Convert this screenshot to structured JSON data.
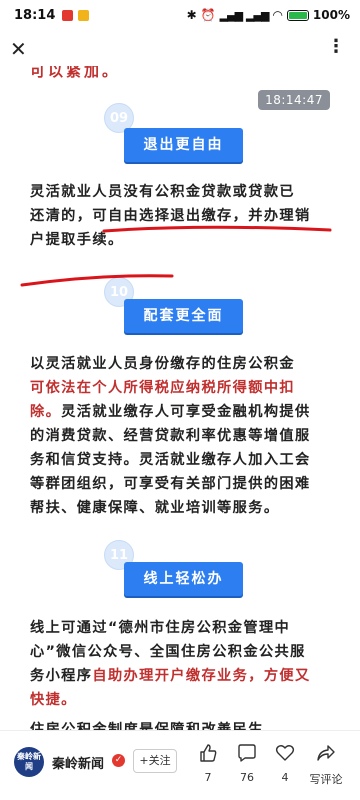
{
  "status_bar": {
    "time": "18:14",
    "battery": "100%"
  },
  "article": {
    "prev_text": "可以紧加。",
    "timestamp": "18:14:47",
    "sections": [
      {
        "number": "09",
        "title": "退出更自由",
        "lines": [
          [
            {
              "t": "灵活就业人员没有公积金贷款或贷款已",
              "red": false
            }
          ],
          [
            {
              "t": "还清的，可自由选择退出缴存，并办理销",
              "red": false
            }
          ],
          [
            {
              "t": "户提取手续。",
              "red": false
            }
          ]
        ]
      },
      {
        "number": "10",
        "title": "配套更全面",
        "lines": [
          [
            {
              "t": "以灵活就业人员身份缴存的住房公积金",
              "red": false
            }
          ],
          [
            {
              "t": "可依法在个人所得税应纳税所得额中扣",
              "red": true
            }
          ],
          [
            {
              "t": "除。",
              "red": true
            },
            {
              "t": "灵活就业缴存人可享受金融机构提供",
              "red": false
            }
          ],
          [
            {
              "t": "的消费贷款、经营贷款利率优惠等增值服",
              "red": false
            }
          ],
          [
            {
              "t": "务和信贷支持。灵活就业缴存人加入工会",
              "red": false
            }
          ],
          [
            {
              "t": "等群团组织，可享受有关部门提供的困难",
              "red": false
            }
          ],
          [
            {
              "t": "帮扶、健康保障、就业培训等服务。",
              "red": false
            }
          ]
        ]
      },
      {
        "number": "11",
        "title": "线上轻松办",
        "lines": [
          [
            {
              "t": "线上可通过“德州市住房公积金管理中",
              "red": false
            }
          ],
          [
            {
              "t": "心”微信公众号、全国住房公积金公共服",
              "red": false
            }
          ],
          [
            {
              "t": "务小程序",
              "red": false
            },
            {
              "t": "自助办理开户缴存业务，方便又",
              "red": true
            }
          ],
          [
            {
              "t": "快捷。",
              "red": true
            }
          ]
        ]
      }
    ],
    "cut_text": "住房公积金制度是保障和改善民生"
  },
  "bottom_bar": {
    "logo_text": "秦岭新闻",
    "account_name": "秦岭新闻",
    "follow_label": "+关注",
    "like_count": "7",
    "comment_count": "76",
    "favorite_count": "4",
    "share_label": "写评论"
  },
  "colors": {
    "accent_blue": "#2d7ef0",
    "highlight_red": "#c0302f",
    "annotation_red": "#d9141b"
  }
}
